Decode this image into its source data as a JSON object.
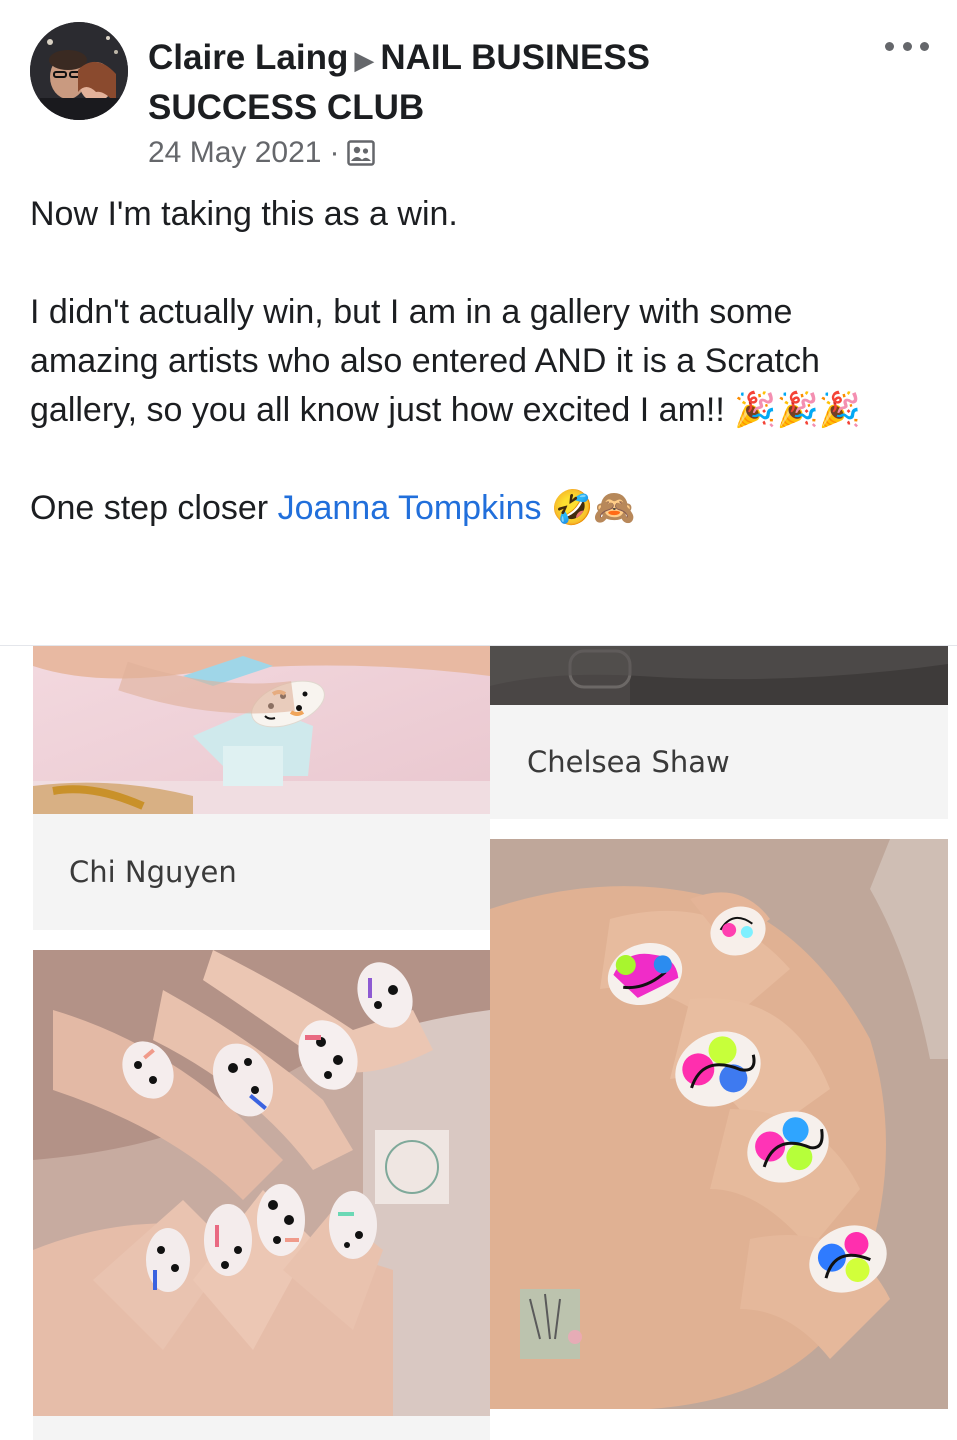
{
  "post": {
    "author": "Claire Laing",
    "group": "NAIL BUSINESS SUCCESS CLUB",
    "date": "24 May 2021",
    "separator": "·",
    "privacy_icon": "group-members-icon",
    "paragraphs": {
      "p1": "Now I'm taking this as a win.",
      "p2": "I didn't actually win, but I am in a gallery with some amazing artists who also entered AND it is a Scratch gallery, so you all know just how excited I am!!",
      "p2_emoji": "🎉🎉🎉",
      "p3_prefix": "One step closer ",
      "p3_mention": "Joanna Tompkins",
      "p3_emoji": "🤣🙈"
    }
  },
  "gallery": {
    "captions": {
      "right_top": "Chelsea Shaw",
      "left_mid": "Chi  Nguyen"
    }
  },
  "colors": {
    "text": "#1c1e21",
    "secondary": "#65676b",
    "link": "#216fdb",
    "caption_bg": "#f4f4f4"
  }
}
